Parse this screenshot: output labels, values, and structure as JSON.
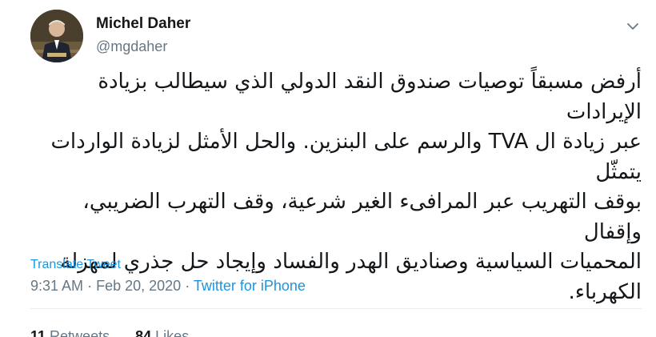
{
  "author": {
    "name": "Michel Daher",
    "handle": "@mgdaher"
  },
  "tweet": {
    "lines": [
      "أرفض مسبقاً توصيات صندوق النقد الدولي الذي سيطالب بزيادة الإيرادات",
      "عبر زيادة ال TVA والرسم على البنزين. والحل الأمثل لزيادة الواردات يتمثّل",
      "بوقف التهريب عبر المرافىء الغير شرعية، وقف التهرب الضريبي، وإقفال",
      "المحميات السياسية وصناديق الهدر والفساد وإيجاد حل جذري لمهزلة",
      "الكهرباء."
    ],
    "translate_label": "Translate Tweet",
    "time": "9:31 AM",
    "separator": "·",
    "date": "Feb 20, 2020",
    "source": "Twitter for iPhone"
  },
  "stats": {
    "retweets_count": "11",
    "retweets_label": "Retweets",
    "likes_count": "84",
    "likes_label": "Likes"
  },
  "icons": {
    "menu": "chevron-down-icon"
  },
  "colors": {
    "link": "#1b95e0",
    "secondary": "#657786",
    "text": "#14171a"
  }
}
